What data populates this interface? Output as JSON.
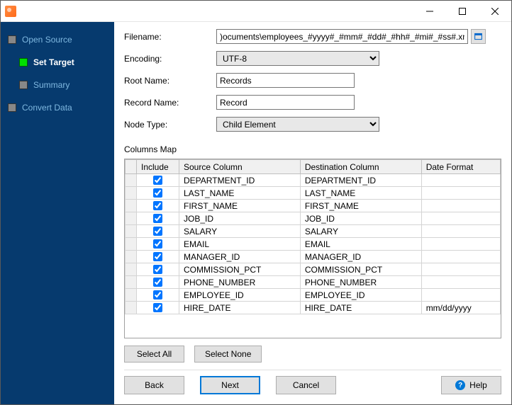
{
  "titlebar": {
    "title": ""
  },
  "sidebar": {
    "items": [
      {
        "label": "Open Source",
        "active": false,
        "sub": false
      },
      {
        "label": "Set Target",
        "active": true,
        "sub": true
      },
      {
        "label": "Summary",
        "active": false,
        "sub": true
      },
      {
        "label": "Convert Data",
        "active": false,
        "sub": false
      }
    ]
  },
  "form": {
    "filename_label": "Filename:",
    "filename_value": ")ocuments\\employees_#yyyy#_#mm#_#dd#_#hh#_#mi#_#ss#.xml",
    "encoding_label": "Encoding:",
    "encoding_value": "UTF-8",
    "rootname_label": "Root Name:",
    "rootname_value": "Records",
    "recordname_label": "Record Name:",
    "recordname_value": "Record",
    "nodetype_label": "Node Type:",
    "nodetype_value": "Child Element"
  },
  "columns_map_label": "Columns Map",
  "table": {
    "headers": {
      "include": "Include",
      "source": "Source Column",
      "dest": "Destination Column",
      "dateformat": "Date Format"
    },
    "rows": [
      {
        "include": true,
        "source": "DEPARTMENT_ID",
        "dest": "DEPARTMENT_ID",
        "dateformat": ""
      },
      {
        "include": true,
        "source": "LAST_NAME",
        "dest": "LAST_NAME",
        "dateformat": ""
      },
      {
        "include": true,
        "source": "FIRST_NAME",
        "dest": "FIRST_NAME",
        "dateformat": ""
      },
      {
        "include": true,
        "source": "JOB_ID",
        "dest": "JOB_ID",
        "dateformat": ""
      },
      {
        "include": true,
        "source": "SALARY",
        "dest": "SALARY",
        "dateformat": ""
      },
      {
        "include": true,
        "source": "EMAIL",
        "dest": "EMAIL",
        "dateformat": ""
      },
      {
        "include": true,
        "source": "MANAGER_ID",
        "dest": "MANAGER_ID",
        "dateformat": ""
      },
      {
        "include": true,
        "source": "COMMISSION_PCT",
        "dest": "COMMISSION_PCT",
        "dateformat": ""
      },
      {
        "include": true,
        "source": "PHONE_NUMBER",
        "dest": "PHONE_NUMBER",
        "dateformat": ""
      },
      {
        "include": true,
        "source": "EMPLOYEE_ID",
        "dest": "EMPLOYEE_ID",
        "dateformat": ""
      },
      {
        "include": true,
        "source": "HIRE_DATE",
        "dest": "HIRE_DATE",
        "dateformat": "mm/dd/yyyy"
      }
    ]
  },
  "buttons": {
    "select_all": "Select All",
    "select_none": "Select None",
    "back": "Back",
    "next": "Next",
    "cancel": "Cancel",
    "help": "Help"
  }
}
